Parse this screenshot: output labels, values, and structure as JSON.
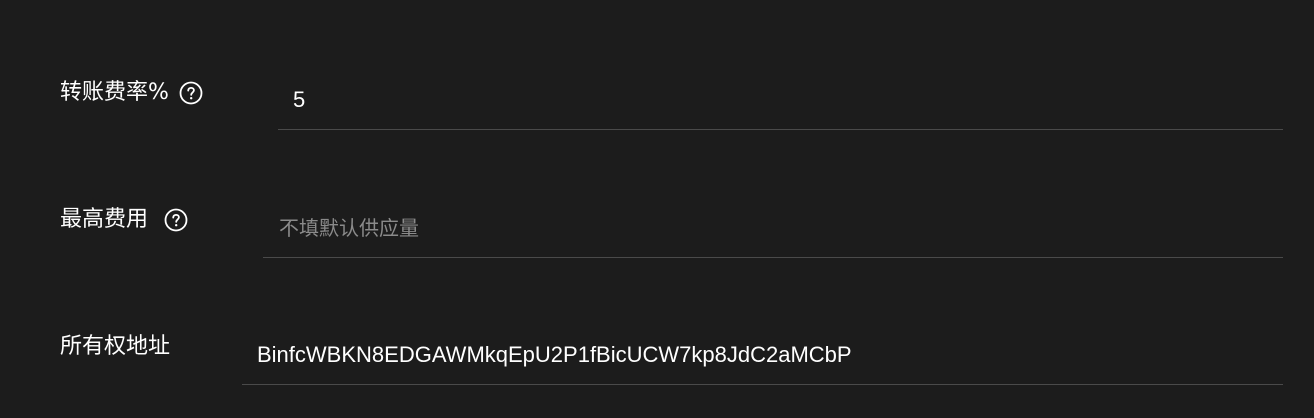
{
  "form": {
    "fee_rate": {
      "label": "转账费率%",
      "value": "5",
      "placeholder": "",
      "help_icon": "question-circle-icon"
    },
    "max_fee": {
      "label": "最高费用",
      "value": "",
      "placeholder": "不填默认供应量",
      "help_icon": "question-circle-icon"
    },
    "owner_address": {
      "label": "所有权地址",
      "value": "BinfcWBKN8EDGAWMkqEpU2P1fBicUCW7kp8JdC2aMCbP",
      "placeholder": ""
    }
  },
  "colors": {
    "background": "#1c1c1c",
    "text": "#ffffff",
    "placeholder": "#8a8a8a",
    "divider": "#4a4a4a"
  }
}
